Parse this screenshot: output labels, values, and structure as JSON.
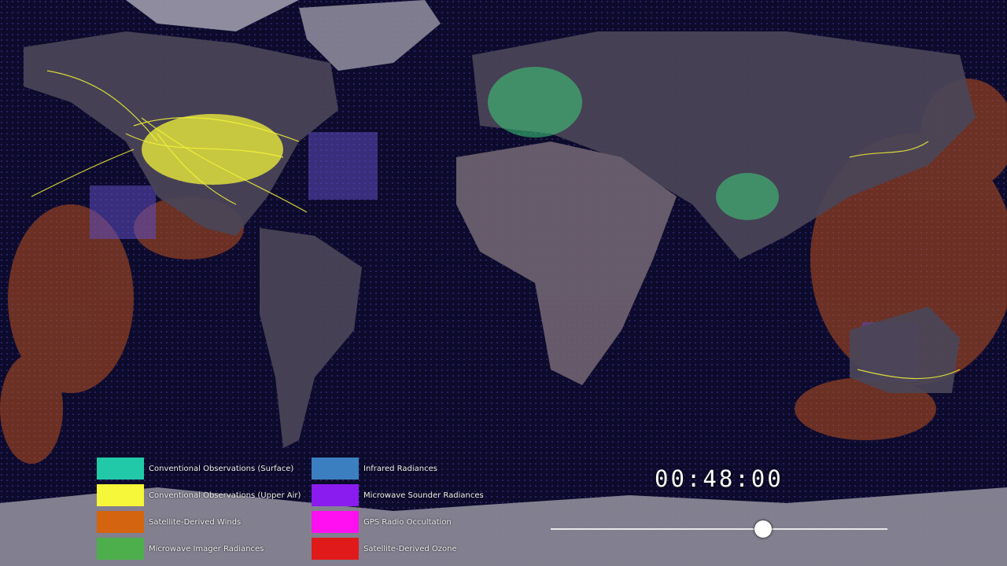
{
  "legend": [
    {
      "label": "Conventional Observations (Surface)",
      "color": "#22c9a9"
    },
    {
      "label": "Conventional Observations (Upper Air)",
      "color": "#f6f63a"
    },
    {
      "label": "Satellite-Derived Winds",
      "color": "#d4640f"
    },
    {
      "label": "Microwave Imager Radiances",
      "color": "#4caf4c"
    },
    {
      "label": "Infrared Radiances",
      "color": "#3b7fc0"
    },
    {
      "label": "Microwave Sounder Radiances",
      "color": "#8a1cf0"
    },
    {
      "label": "GPS Radio Occultation",
      "color": "#ff10f0"
    },
    {
      "label": "Satellite-Derived Ozone",
      "color": "#e01a1a"
    }
  ],
  "timer": "00:48:00",
  "playback_progress": 0.63
}
